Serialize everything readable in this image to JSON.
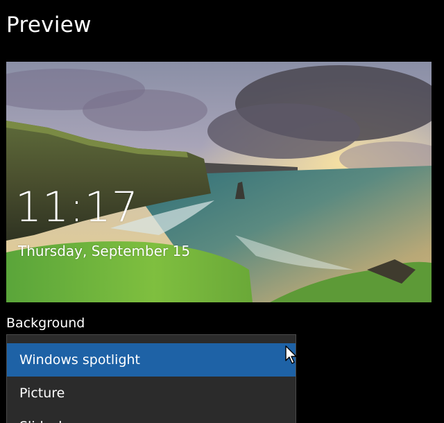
{
  "header": {
    "title": "Preview"
  },
  "preview": {
    "time": "11:17",
    "date": "Thursday, September 15"
  },
  "background_setting": {
    "label": "Background",
    "options": [
      {
        "label": "Windows spotlight",
        "selected": true
      },
      {
        "label": "Picture",
        "selected": false
      },
      {
        "label": "Slideshow",
        "selected": false
      }
    ]
  },
  "colors": {
    "page_background": "#000000",
    "dropdown_background": "#2b2b2b",
    "selected_option": "#1e62a6",
    "text": "#ffffff"
  },
  "icons": {
    "cursor": "mouse-pointer-icon"
  }
}
